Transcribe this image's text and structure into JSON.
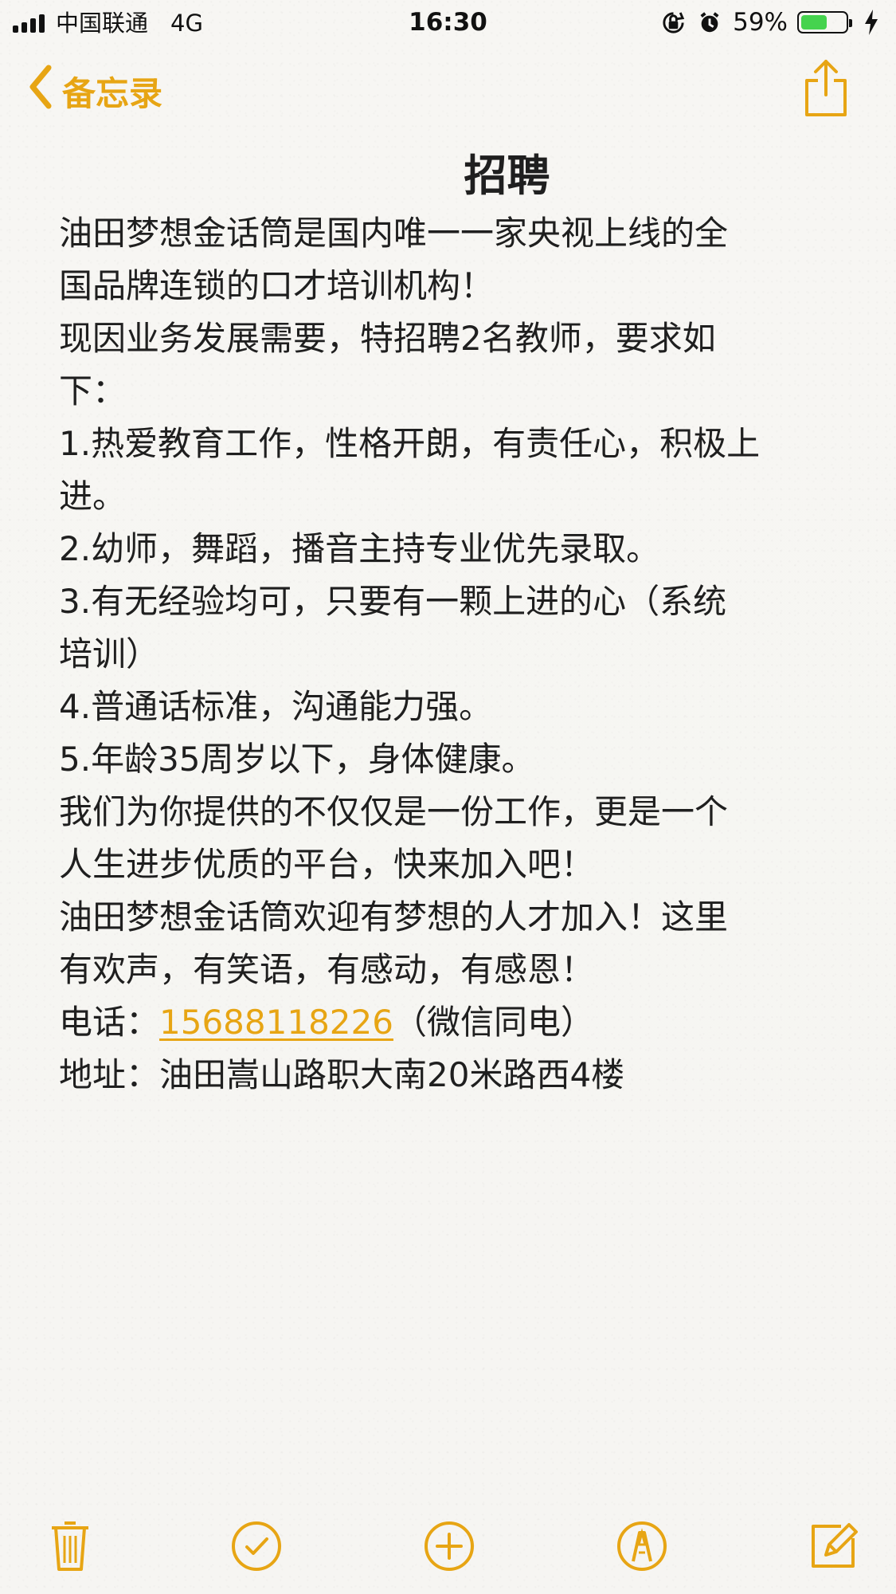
{
  "status_bar": {
    "carrier": "中国联通",
    "network": "4G",
    "time": "16:30",
    "battery_percent": "59%",
    "battery_level": 0.59
  },
  "navigation": {
    "back_label": "备忘录"
  },
  "note": {
    "title": "招聘",
    "lines": [
      "油田梦想金话筒是国内唯一一家央视上线的全",
      "国品牌连锁的口才培训机构！",
      "现因业务发展需要，特招聘2名教师，要求如",
      "下：",
      "1.热爱教育工作，性格开朗，有责任心，积极上",
      "进。",
      "2.幼师，舞蹈，播音主持专业优先录取。",
      "3.有无经验均可，只要有一颗上进的心（系统",
      "培训）",
      "4.普通话标准，沟通能力强。",
      "5.年龄35周岁以下，身体健康。",
      "我们为你提供的不仅仅是一份工作，更是一个",
      "人生进步优质的平台，快来加入吧！",
      "油田梦想金话筒欢迎有梦想的人才加入！这里",
      "有欢声，有笑语，有感动，有感恩！"
    ],
    "phone_label": "电话：",
    "phone_number": "15688118226",
    "phone_note": "（微信同电）",
    "address_line": "地址：油田嵩山路职大南20米路西4楼"
  },
  "colors": {
    "accent": "#e7a514",
    "battery": "#45d34e",
    "background": "#f6f5f2"
  },
  "icons": {
    "status": [
      "signal-bars-icon",
      "orientation-lock-icon",
      "alarm-clock-icon",
      "battery-icon",
      "charging-bolt-icon"
    ],
    "navigation": [
      "chevron-left-icon",
      "share-icon"
    ],
    "toolbar": [
      "trash-icon",
      "checklist-icon",
      "add-icon",
      "markup-icon",
      "compose-icon"
    ]
  }
}
